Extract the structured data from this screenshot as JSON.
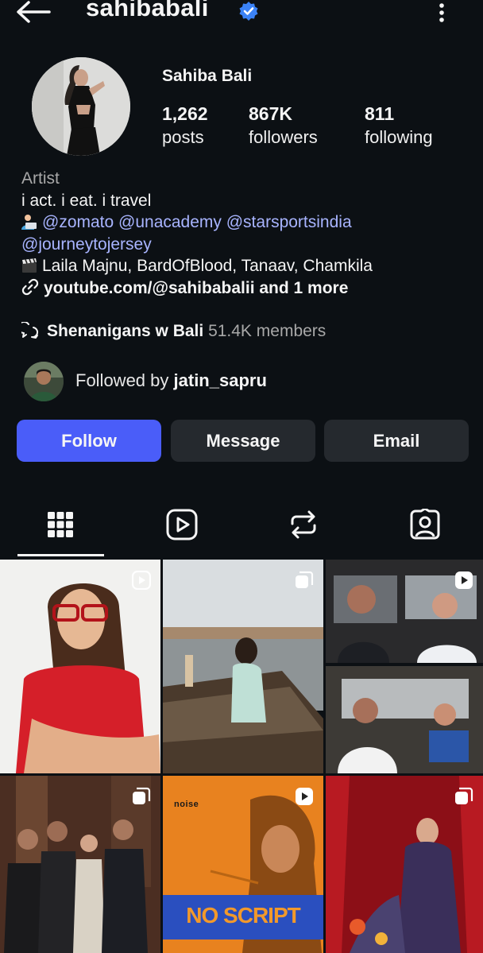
{
  "header": {
    "username": "sahibabali",
    "back_icon": "back-arrow-icon",
    "verified_icon": "verified-badge-icon",
    "more_icon": "more-vertical-icon"
  },
  "profile": {
    "display_name": "Sahiba Bali",
    "stats": [
      {
        "value": "1,262",
        "label": "posts"
      },
      {
        "value": "867K",
        "label": "followers"
      },
      {
        "value": "811",
        "label": "following"
      }
    ]
  },
  "bio": {
    "category": "Artist",
    "line1": "i act. i eat. i travel",
    "mentions_line1": "@zomato @unacademy @starsportsindia",
    "mentions_line2": "@journeytojersey",
    "works": "Laila Majnu, BardOfBlood, Tanaav, Chamkila",
    "link": "youtube.com/@sahibabalii and 1 more"
  },
  "channel": {
    "name": "Shenanigans w Bali",
    "members": "51.4K members"
  },
  "followed_by": {
    "prefix": "Followed by ",
    "user": "jatin_sapru"
  },
  "buttons": {
    "follow": "Follow",
    "message": "Message",
    "email": "Email"
  },
  "tabs": [
    "grid-icon",
    "reels-icon",
    "reposts-icon",
    "tagged-icon"
  ],
  "grid_text": {
    "tile5_brand": "noise",
    "tile5_banner": "NO SCRIPT"
  },
  "colors": {
    "background": "#0c1014",
    "primary_button": "#4a5df9",
    "secondary_button": "#25292e",
    "link": "#a8b4ff",
    "verified": "#3b82f6"
  }
}
